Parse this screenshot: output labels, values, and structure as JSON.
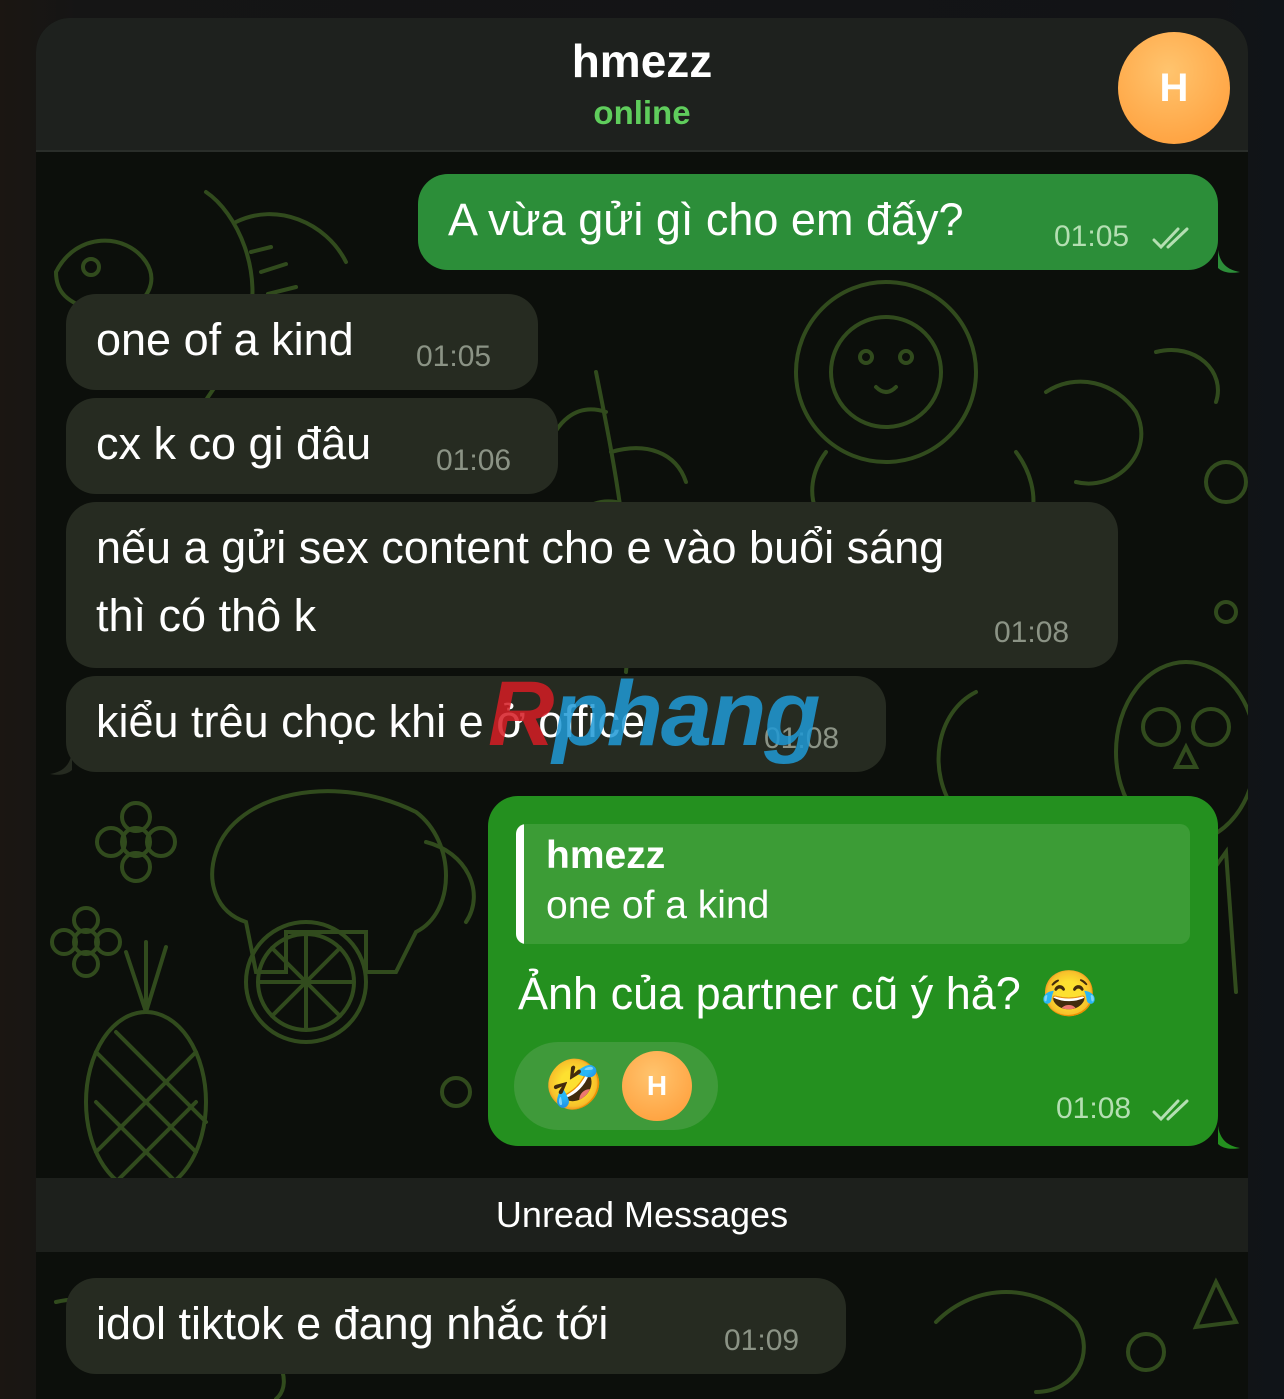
{
  "header": {
    "title": "hmezz",
    "status": "online",
    "avatar_initial": "H",
    "status_color": "#5fcd5c",
    "avatar_color": "#ffa845"
  },
  "messages": [
    {
      "direction": "outgoing",
      "text": "A vừa gửi gì cho em đấy?",
      "time": "01:05",
      "read": true
    },
    {
      "direction": "incoming",
      "text": "one of a kind",
      "time": "01:05"
    },
    {
      "direction": "incoming",
      "text": "cx k co gi đâu",
      "time": "01:06"
    },
    {
      "direction": "incoming",
      "text_line1": "nếu a gửi sex content cho e vào buổi sáng",
      "text_line2": "thì có thô k",
      "time": "01:08"
    },
    {
      "direction": "incoming",
      "text": "kiểu trêu chọc khi e ở office",
      "time": "01:08"
    },
    {
      "direction": "outgoing",
      "reply_to": {
        "name": "hmezz",
        "text": "one of a kind"
      },
      "text": "Ảnh của partner cũ ý hả?",
      "emoji": "😂",
      "reaction_emoji": "🤣",
      "reaction_avatar_initial": "H",
      "time": "01:08",
      "read": true
    }
  ],
  "unread_divider": "Unread Messages",
  "last_message": {
    "direction": "incoming",
    "text": "idol tiktok e đang nhắc tới",
    "time": "01:09"
  },
  "watermark": {
    "first": "R",
    "rest": "phang"
  },
  "colors": {
    "incoming_bubble": "#262b21",
    "outgoing_bubble": "#2c8e39",
    "background": "#0c0f0b"
  }
}
